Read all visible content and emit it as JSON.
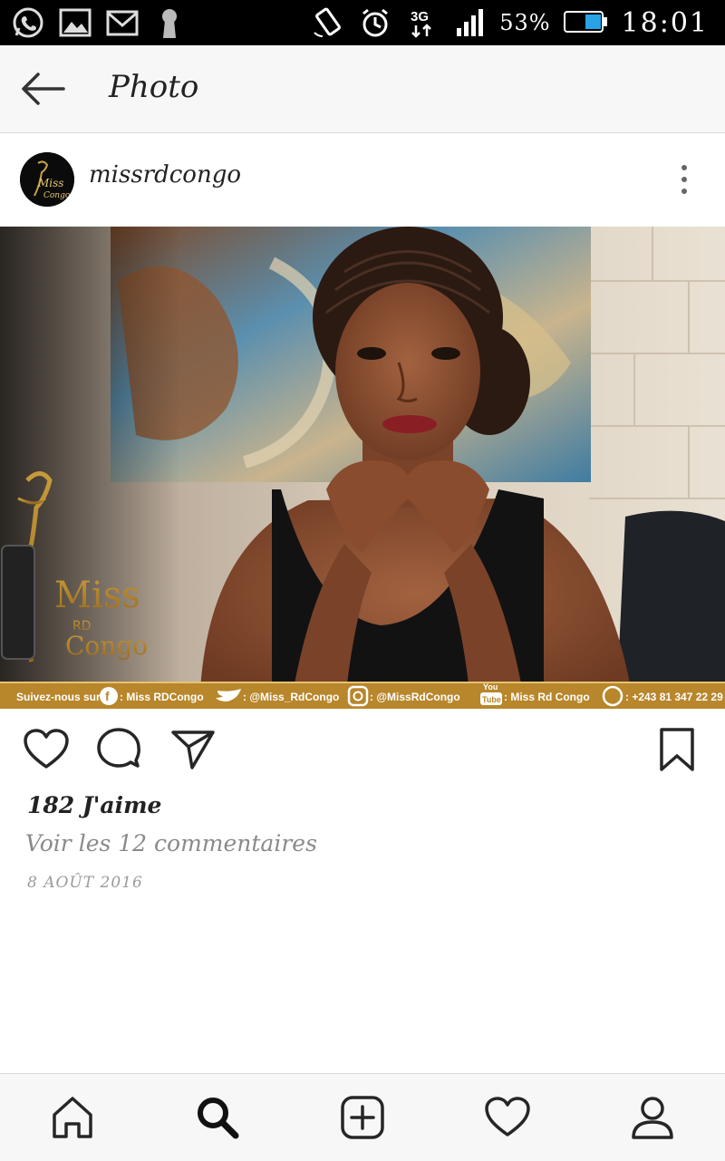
{
  "status_bar": {
    "left_icons": [
      "whatsapp-icon",
      "gallery-icon",
      "gmail-icon",
      "keyhole-icon"
    ],
    "right_icons": [
      "rotate-icon",
      "alarm-icon",
      "network-3g-icon",
      "signal-icon",
      "battery-icon"
    ],
    "network": "3G",
    "battery": "53%",
    "battery_level": 0.53,
    "time": "18:01"
  },
  "app_bar": {
    "back_icon": "back-arrow-icon",
    "title": "Photo"
  },
  "post": {
    "username": "missrdcongo",
    "avatar_icon": "miss-rd-congo-logo",
    "more_icon": "more-vertical-icon",
    "photo": {
      "logo_line1": "Miss",
      "logo_line2": "RD",
      "logo_line3": "Congo",
      "banner": {
        "prefix": "Suivez-nous sur",
        "facebook": ": Miss RDCongo",
        "twitter": ": @Miss_RdCongo",
        "instagram": ": @MissRdCongo",
        "youtube": ": Miss Rd Congo",
        "whatsapp": ": +243 81 347 22 29"
      }
    },
    "actions": {
      "like_icon": "heart-icon",
      "comment_icon": "comment-icon",
      "share_icon": "send-icon",
      "save_icon": "bookmark-icon"
    },
    "likes": "182 J'aime",
    "comments_link": "Voir les 12 commentaires",
    "date": "8 AOÛT 2016"
  },
  "bottom_nav": {
    "items": [
      "home-icon",
      "search-icon",
      "add-icon",
      "activity-icon",
      "profile-icon"
    ]
  },
  "colors": {
    "status_bar_bg": "#000000",
    "app_bar_bg": "#f7f7f7",
    "banner_gold": "#b8862b",
    "text_dark": "#222222",
    "text_muted": "#8a8a8a"
  }
}
